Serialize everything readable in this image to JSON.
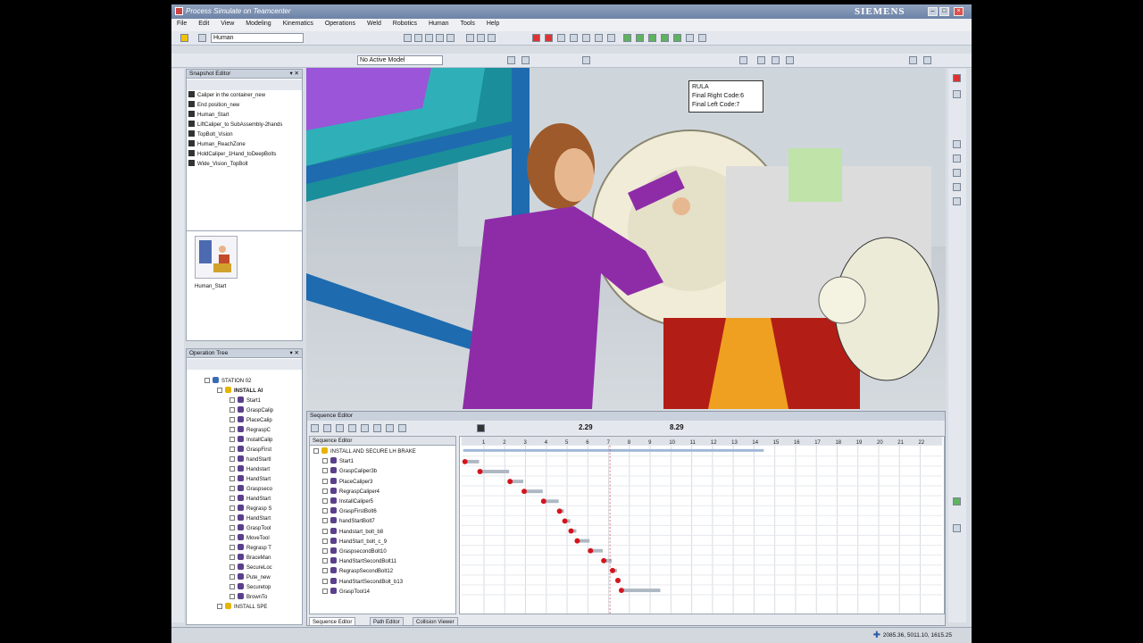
{
  "window": {
    "title": "Process Simulate on Teamcenter",
    "brand": "SIEMENS"
  },
  "menu": [
    "File",
    "Edit",
    "View",
    "Modeling",
    "Kinematics",
    "Operations",
    "Weld",
    "Robotics",
    "Human",
    "Tools",
    "Help"
  ],
  "toolbar": {
    "object_combo": "Human",
    "filter_combo": "No Active Model"
  },
  "snapshot_editor": {
    "title": "Snapshot Editor",
    "items": [
      "Caliper in the container_new",
      "End position_new",
      "Human_Start",
      "LiftCaliper_to SubAssembly-2hands",
      "TopBolt_Vision",
      "Human_ReachZone",
      "HoldCaliper_1Hand_toDeepBolts",
      "Wide_Vision_TopBolt"
    ],
    "thumbnail_label": "Human_Start"
  },
  "operation_tree": {
    "title": "Operation Tree",
    "rows": [
      "STATION 02",
      "INSTALL AI",
      "Start1",
      "GraspCalip",
      "PlaceCalip",
      "RegraspC",
      "InstallCalip",
      "GraspFirst",
      "handStartI",
      "Handstart",
      "HandStart",
      "Graspseco",
      "HandStart",
      "Regrasp S",
      "HandStart",
      "GraspTool",
      "MoveTool",
      "Regrasp T",
      "BraceMan",
      "SecureLoc",
      "Pute_new",
      "Securetop",
      "BrownTo",
      "INSTALL SPE"
    ]
  },
  "rula": {
    "title": "RULA",
    "right": "Final Right Code:6",
    "left": "Final Left Code:7"
  },
  "sequence_editor": {
    "title": "Sequence Editor",
    "time_current": "2.29",
    "time_total": "8.29",
    "tree_header": "Sequence Editor",
    "rows": [
      "INSTALL AND SECURE LH BRAKE",
      "Start1",
      "GraspCaliper3b",
      "PlaceCaliper3",
      "RegraspCaliper4",
      "InstallCaliper5",
      "GraspFirstBolt6",
      "handStartBolt7",
      "Handstart_bolt_b8",
      "HandStart_bolt_c_9",
      "GraspsecondBolt10",
      "HandStartSecondBolt11",
      "RegraspSecondBolt12",
      "HandStartSecondBolt_b13",
      "GraspTool14"
    ],
    "ruler_ticks": [
      "1",
      "2",
      "3",
      "4",
      "5",
      "6",
      "7",
      "8",
      "9",
      "10",
      "11",
      "12",
      "13",
      "14",
      "15",
      "16",
      "17",
      "18",
      "19",
      "20",
      "21",
      "22"
    ],
    "tabs": [
      "Sequence Editor",
      "Path Editor",
      "Collision Viewer"
    ]
  },
  "status": {
    "coords": "2085.36, 5011.10, 1615.25"
  },
  "colors": {
    "accent": "#2b5aa8",
    "human_shirt": "#8e2ca8",
    "gantt_marker": "#d4141c"
  }
}
